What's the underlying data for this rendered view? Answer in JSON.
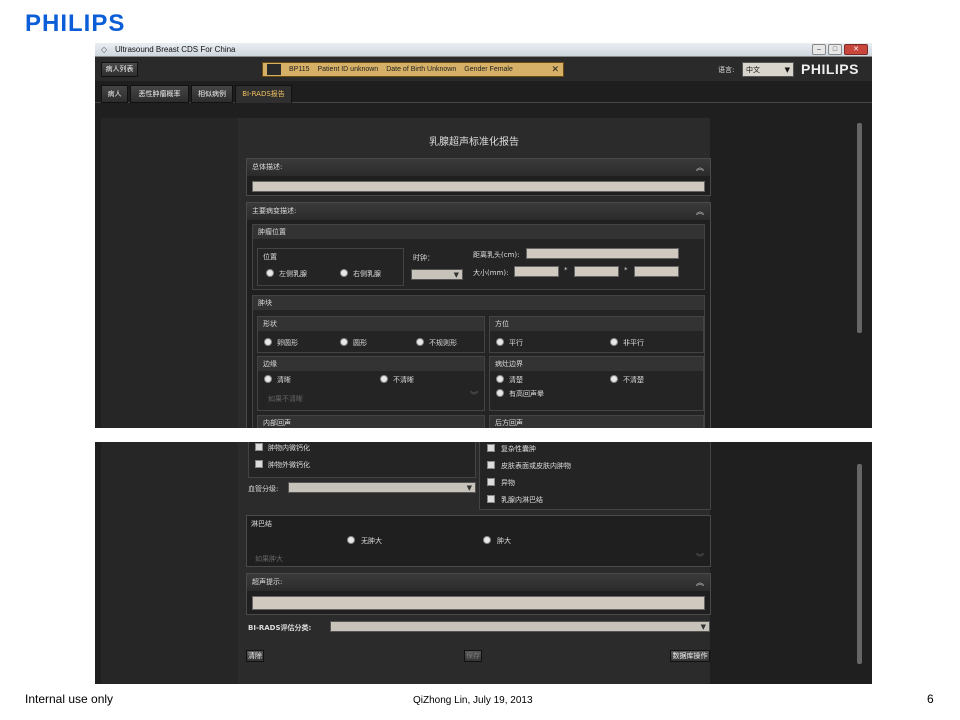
{
  "slide": {
    "logo": "PHILIPS",
    "footer_left": "Internal use only",
    "footer_center": "QiZhong Lin, July 19, 2013",
    "page_number": "6"
  },
  "window": {
    "title": "Ultrasound Breast CDS For China",
    "brand": "PHILIPS"
  },
  "toolbar": {
    "patient_list_button": "病人列表",
    "patient": {
      "id_label": "BP115",
      "patient_id": "Patient ID unknown",
      "dob": "Date of Birth Unknown",
      "gender": "Gender Female"
    },
    "language_label": "语言:",
    "language_value": "中文"
  },
  "tabs": [
    {
      "label": "病人"
    },
    {
      "label": "恶性肿瘤概率"
    },
    {
      "label": "相似病例"
    },
    {
      "label": "BI-RADS报告"
    }
  ],
  "report": {
    "title": "乳腺超声标准化报告",
    "general_desc_label": "总体描述:",
    "main_lesion_label": "主要病变描述:",
    "tumor_location": {
      "label": "肿瘤位置",
      "position_label": "位置",
      "left_breast": "左侧乳腺",
      "right_breast": "右侧乳腺",
      "clock_label": "时钟：",
      "nipple_distance_label": "距离乳头(cm):",
      "size_label": "大小(mm):",
      "size_separator": "*"
    },
    "mass": {
      "label": "肿块",
      "shape_label": "形状",
      "shape_options": [
        "卵圆形",
        "圆形",
        "不规则形"
      ],
      "orientation_label": "方位",
      "orientation_options": [
        "平行",
        "非平行"
      ],
      "margin_label": "边缘",
      "margin_options": [
        "清晰",
        "不清晰"
      ],
      "margin_placeholder": "如果不清晰",
      "boundary_label": "病灶边界",
      "boundary_options": [
        "清楚",
        "不清楚",
        "有高回声晕"
      ],
      "internal_echo_label": "内部回声",
      "posterior_echo_label": "后方回声"
    },
    "lower": {
      "calc_in_mass": "肿物内微钙化",
      "calc_out_mass": "肿物外微钙化",
      "complex_cyst": "复杂性囊肿",
      "skin_mass": "皮肤表面或皮肤内肿物",
      "foreign_body": "异物",
      "lymph_in_breast": "乳腺内淋巴结",
      "vascular_label": "血管分级:"
    },
    "lymph": {
      "label": "淋巴结",
      "options": [
        "无肿大",
        "肿大"
      ],
      "placeholder": "如果肿大"
    },
    "ultrasound_hint_label": "超声提示:",
    "birads_label": "BI-RADS评估分类:",
    "buttons": {
      "clear": "清除",
      "save": "保存",
      "db": "数据库操作"
    }
  }
}
